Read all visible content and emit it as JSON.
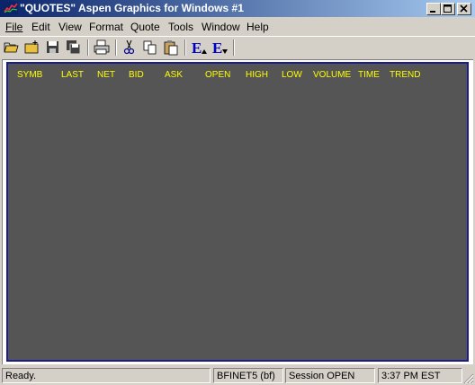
{
  "window": {
    "title": "\"QUOTES\" Aspen Graphics for Windows #1"
  },
  "titlebar_buttons": {
    "minimize": "_",
    "maximize": "□",
    "close": "✕"
  },
  "menu": [
    {
      "label": "File"
    },
    {
      "label": "Edit"
    },
    {
      "label": "View"
    },
    {
      "label": "Format"
    },
    {
      "label": "Quote"
    },
    {
      "label": "Tools"
    },
    {
      "label": "Window"
    },
    {
      "label": "Help"
    }
  ],
  "toolbar": {
    "icons": [
      "open-folder-icon",
      "new-folder-icon",
      "save-icon",
      "save-all-icon",
      "print-icon",
      "cut-icon",
      "copy-icon",
      "paste-icon",
      "formula-up-icon",
      "formula-down-icon"
    ],
    "formula_glyph": "E"
  },
  "quotes": {
    "columns": [
      "SYMB",
      "LAST",
      "NET",
      "BID",
      "ASK",
      "OPEN",
      "HIGH",
      "LOW",
      "VOLUME",
      "TIME",
      "TREND"
    ],
    "header_color": "#ffff00",
    "background_color": "#555555"
  },
  "status": {
    "message": "Ready.",
    "feed": "BFINET5 (bf)",
    "session": "Session OPEN",
    "time": "3:37 PM EST"
  }
}
